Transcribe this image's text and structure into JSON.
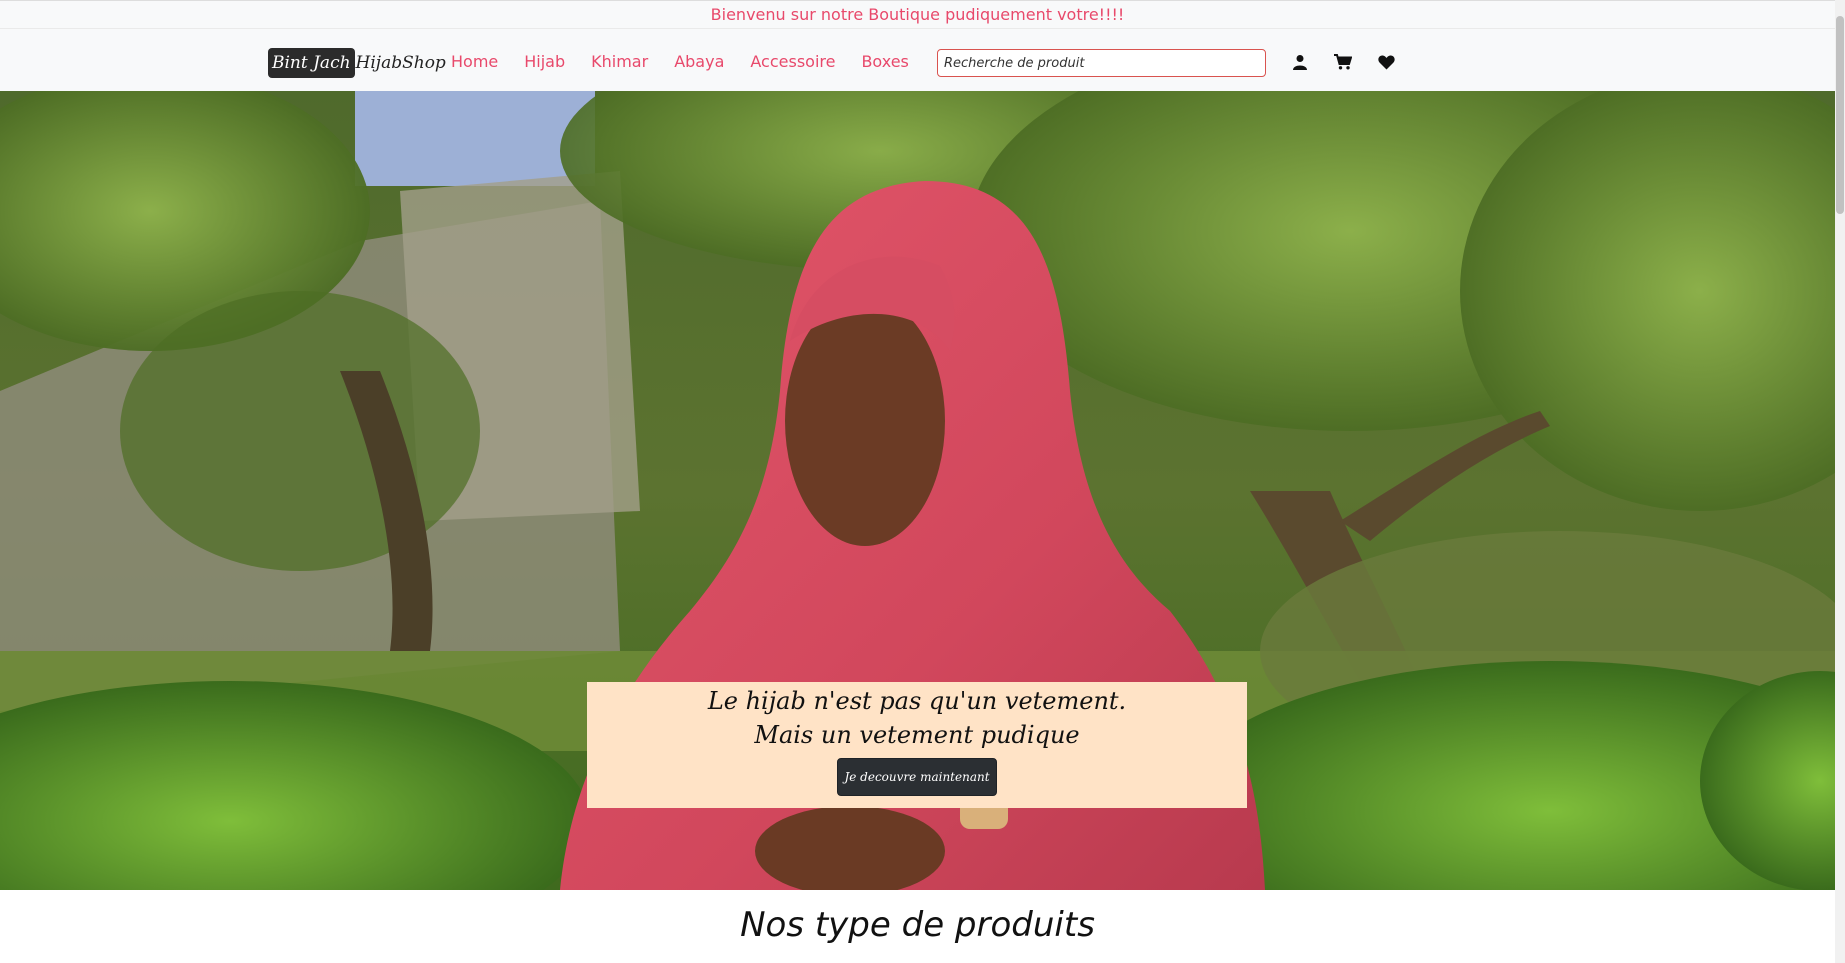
{
  "announcement": "Bienvenu sur notre Boutique pudiquement votre!!!!",
  "brand": {
    "part1": "Bint Jach",
    "part2": "HijabShop"
  },
  "nav": {
    "links": [
      "Home",
      "Hijab",
      "Khimar",
      "Abaya",
      "Accessoire",
      "Boxes"
    ]
  },
  "search": {
    "placeholder": "Recherche de produit",
    "value": ""
  },
  "icons": [
    "user-icon",
    "cart-icon",
    "heart-icon"
  ],
  "hero": {
    "line1": "Le hijab n'est pas qu'un vetement.",
    "line2": "Mais un vetement pudique",
    "cta": "Je decouvre maintenant"
  },
  "section": {
    "title": "Nos type de produits"
  },
  "colors": {
    "accent": "#e8496b",
    "caption_bg": "#ffe3c6",
    "dark": "#2b2f33"
  }
}
